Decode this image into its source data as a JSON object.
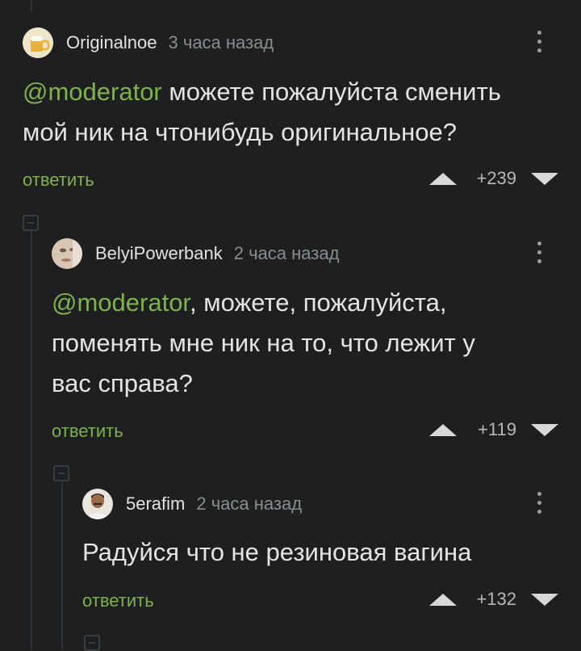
{
  "comments": [
    {
      "username": "Originalnoe",
      "time": "3 часа назад",
      "mention": "@moderator",
      "text_lines": [
        " можете пожалуйста сменить",
        "мой ник на чтонибудь оригинальное?"
      ],
      "reply_label": "ответить",
      "score": "+239",
      "avatar_icon": "beer-mug-avatar"
    },
    {
      "username": "BelyiPowerbank",
      "time": "2 часа назад",
      "mention": "@moderator",
      "text_lines": [
        ", можете, пожалуйста,",
        "поменять мне ник на то, что лежит у",
        "вас справа?"
      ],
      "reply_label": "ответить",
      "score": "+119",
      "avatar_icon": "face-closeup-avatar"
    },
    {
      "username": "5erafim",
      "time": "2 часа назад",
      "text_lines": [
        "Радуйся что не резиновая вагина"
      ],
      "reply_label": "ответить",
      "score": "+132",
      "avatar_icon": "man-portrait-avatar"
    }
  ],
  "colors": {
    "background": "#1d1f20",
    "accent_green": "#7fb24a",
    "text": "#e4e4e4",
    "muted": "#8a8d8f"
  }
}
